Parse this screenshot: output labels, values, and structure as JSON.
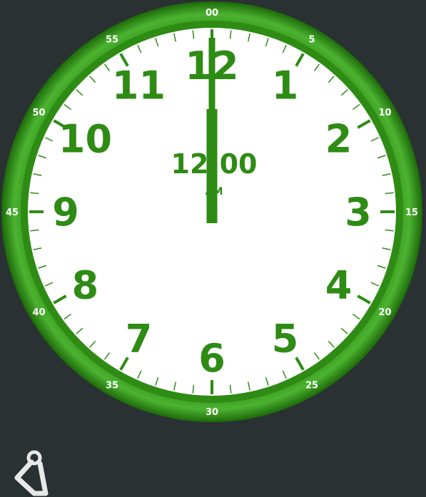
{
  "clock": {
    "hour_numbers": [
      "12",
      "1",
      "2",
      "3",
      "4",
      "5",
      "6",
      "7",
      "8",
      "9",
      "10",
      "11"
    ],
    "minute_labels": [
      "00",
      "5",
      "10",
      "15",
      "20",
      "25",
      "30",
      "35",
      "40",
      "45",
      "50",
      "55"
    ],
    "digital_time": "12:00",
    "digital_ampm": "AM",
    "hour_hand_value": 12,
    "minute_hand_value": 0
  },
  "colors": {
    "background": "#2a3133",
    "ring": "#2e8b14",
    "ring_dark": "#1f6e0a",
    "ring_light": "#43a82a",
    "face": "#ffffff",
    "accent": "#2e8b14",
    "tick": "#2e8b14",
    "tool_icon": "#e8e8e8"
  },
  "tool": {
    "icon": "pin-tool-icon"
  }
}
